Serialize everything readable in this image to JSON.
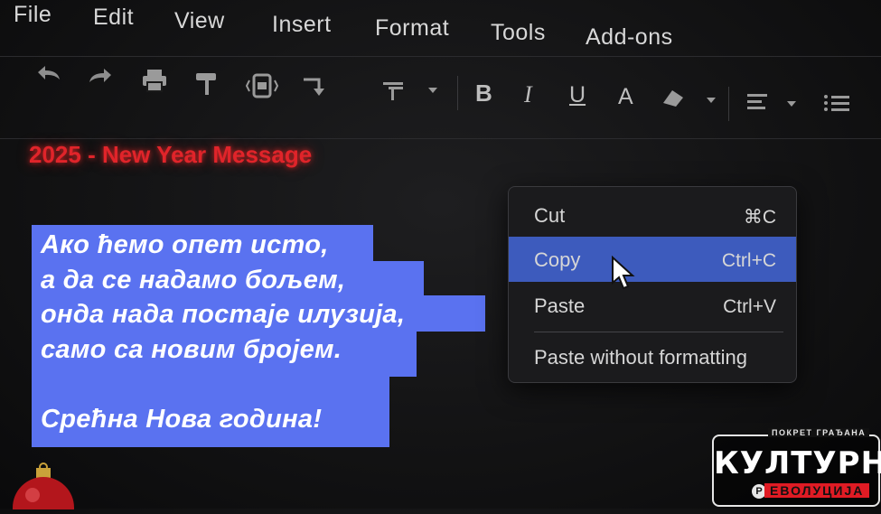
{
  "menu": {
    "items": [
      "File",
      "Edit",
      "View",
      "Insert",
      "Format",
      "Tools",
      "Add-ons"
    ]
  },
  "toolbar": {
    "buttons": [
      "undo-icon",
      "redo-icon",
      "print-icon",
      "paint-format-icon",
      "zoom-icon",
      "crop-icon",
      "text-style-icon",
      "bold-icon",
      "italic-icon",
      "underline-icon",
      "text-color-icon",
      "highlight-icon",
      "align-icon",
      "list-icon"
    ],
    "bold_label": "B",
    "italic_label": "I",
    "underline_label": "U",
    "text_color_label": "A"
  },
  "document": {
    "title": "2025 - New Year Message",
    "title_color": "#e0242a",
    "selection_color": "#5a72f0",
    "lines": [
      "Ако ћемо опет исто,",
      "а да се надамо бољем,",
      "онда нада постаје илузија,",
      "само са новим бројем.",
      "Срећна Нова година!"
    ]
  },
  "context_menu": {
    "items": [
      {
        "label": "Cut",
        "shortcut": "⌘C"
      },
      {
        "label": "Copy",
        "shortcut": "Ctrl+C",
        "selected": true
      },
      {
        "label": "Paste",
        "shortcut": "Ctrl+V"
      },
      {
        "label": "Paste without formatting",
        "shortcut": ""
      }
    ],
    "selected_color": "#3d5bbd"
  },
  "logo": {
    "top_text": "ПОКРЕТ ГРАЂАНА",
    "main_text": "КУЛТУРНА",
    "sub_text": "ЕВОЛУЦИЈА",
    "mark": "Р"
  }
}
